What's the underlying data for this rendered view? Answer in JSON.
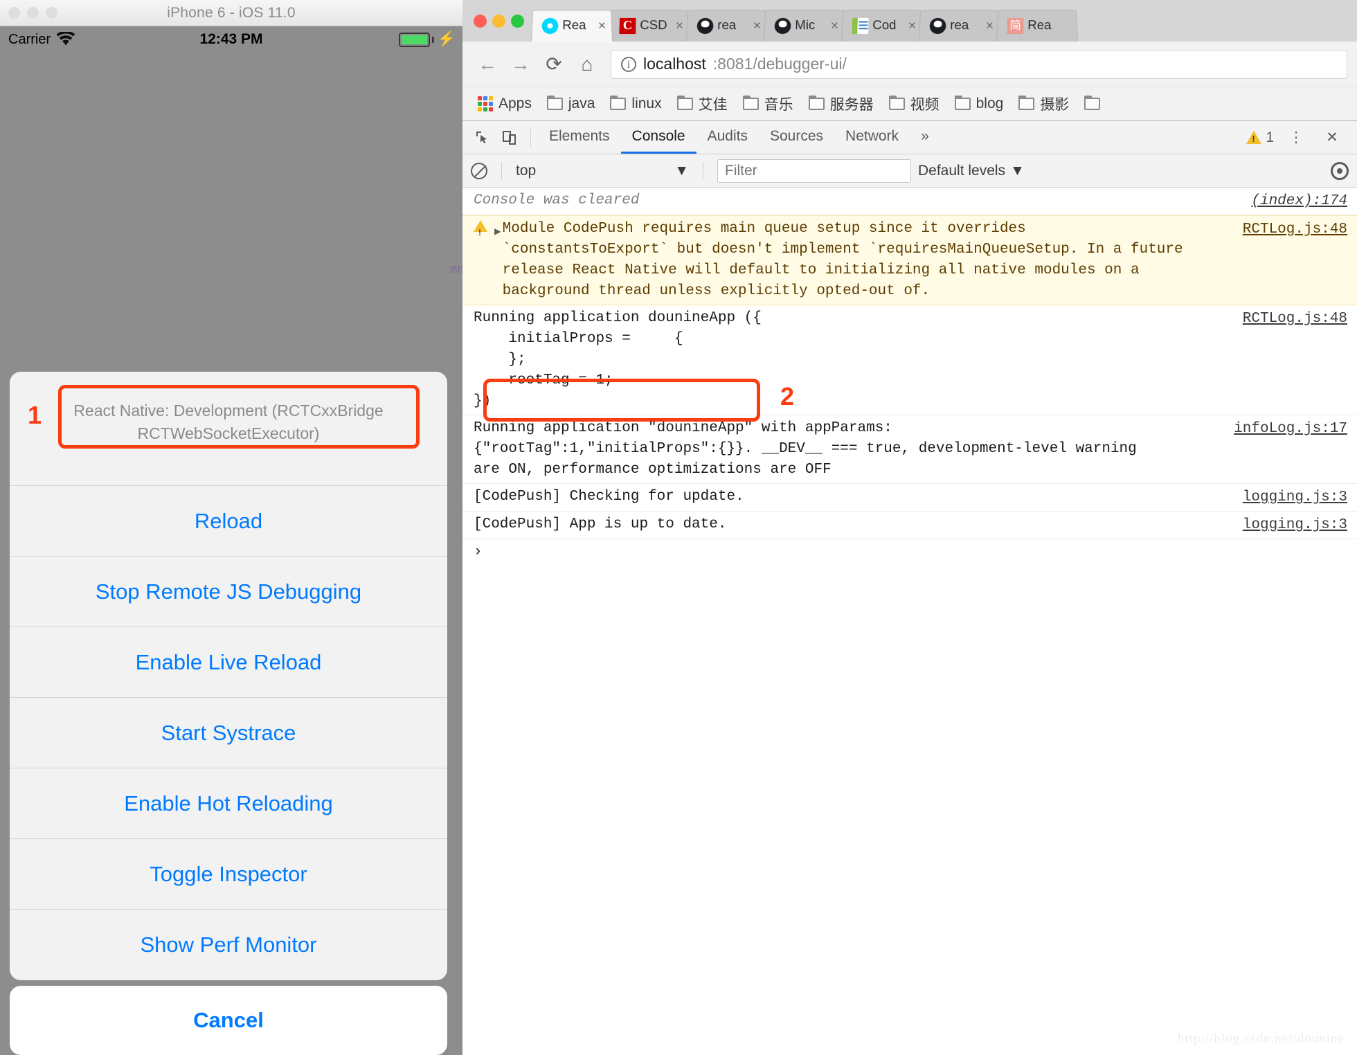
{
  "simulator": {
    "window_title": "iPhone 6 - iOS 11.0",
    "status_bar": {
      "carrier": "Carrier",
      "time": "12:43 PM",
      "wifi_icon": "wifi-icon",
      "battery_icon": "battery-icon",
      "charging_icon": "lightning-bolt-icon"
    },
    "action_sheet": {
      "header": "React Native: Development (RCTCxxBridge RCTWebSocketExecutor)",
      "items": [
        {
          "label": "Reload",
          "highlighted": false
        },
        {
          "label": "Stop Remote JS Debugging",
          "highlighted": true
        },
        {
          "label": "Enable Live Reload",
          "highlighted": false
        },
        {
          "label": "Start Systrace",
          "highlighted": false
        },
        {
          "label": "Enable Hot Reloading",
          "highlighted": false
        },
        {
          "label": "Toggle Inspector",
          "highlighted": false
        },
        {
          "label": "Show Perf Monitor",
          "highlighted": false
        }
      ],
      "cancel_label": "Cancel"
    }
  },
  "annotations": [
    {
      "number": "1",
      "target": "Stop Remote JS Debugging"
    },
    {
      "number": "2",
      "target": "[CodePush] console output"
    }
  ],
  "annotation_color": "#fa3c11",
  "browser": {
    "traffic_lights": [
      "close",
      "minimize",
      "zoom"
    ],
    "tabs": [
      {
        "title": "Rea",
        "favicon": "react-icon",
        "active": true
      },
      {
        "title": "CSD",
        "favicon": "csdn-icon",
        "active": false
      },
      {
        "title": "rea",
        "favicon": "github-icon",
        "active": false
      },
      {
        "title": "Mic",
        "favicon": "github-icon",
        "active": false
      },
      {
        "title": "Cod",
        "favicon": "code-icon",
        "active": false
      },
      {
        "title": "rea",
        "favicon": "github-icon",
        "active": false
      },
      {
        "title": "Rea",
        "favicon": "jianshu-icon",
        "active": false
      }
    ],
    "tab_close_label": "×",
    "nav": {
      "back": "←",
      "forward": "→",
      "reload": "⟳",
      "home": "⌂"
    },
    "omnibox": {
      "host": "localhost",
      "path": ":8081/debugger-ui/",
      "info_icon": "info-icon"
    },
    "bookmarks": [
      {
        "label": "Apps",
        "icon": "apps-grid-icon"
      },
      {
        "label": "java",
        "icon": "folder-icon"
      },
      {
        "label": "linux",
        "icon": "folder-icon"
      },
      {
        "label": "艾佳",
        "icon": "folder-icon"
      },
      {
        "label": "音乐",
        "icon": "folder-icon"
      },
      {
        "label": "服务器",
        "icon": "folder-icon"
      },
      {
        "label": "视频",
        "icon": "folder-icon"
      },
      {
        "label": "blog",
        "icon": "folder-icon"
      },
      {
        "label": "摄影",
        "icon": "folder-icon"
      },
      {
        "label": "",
        "icon": "folder-icon"
      }
    ]
  },
  "devtools": {
    "tabs": [
      {
        "label": "Elements",
        "active": false
      },
      {
        "label": "Console",
        "active": true
      },
      {
        "label": "Audits",
        "active": false
      },
      {
        "label": "Sources",
        "active": false
      },
      {
        "label": "Network",
        "active": false
      }
    ],
    "more_label": "»",
    "warning_count": "1",
    "menu_icon": "kebab-menu-icon",
    "close_icon": "close-icon",
    "inspect_icon": "inspect-element-icon",
    "device_icon": "device-toolbar-icon",
    "filters": {
      "clear_icon": "clear-console-icon",
      "context": "top",
      "context_caret": "▼",
      "filter_placeholder": "Filter",
      "filter_value": "",
      "levels_label": "Default levels",
      "levels_caret": "▼",
      "settings_icon": "gear-icon"
    },
    "console_rows": [
      {
        "type": "cleared",
        "text": "Console was cleared",
        "source": "(index):174"
      },
      {
        "type": "warning",
        "text": "Module CodePush requires main queue setup since it overrides\n`constantsToExport` but doesn't implement `requiresMainQueueSetup. In a future\nrelease React Native will default to initializing all native modules on a\nbackground thread unless explicitly opted-out of.",
        "source": "RCTLog.js:48",
        "has_disclosure": true,
        "has_warn_icon": true
      },
      {
        "type": "log",
        "text": "Running application dounineApp ({\n    initialProps =     {\n    };\n    rootTag = 1;\n})",
        "source": "RCTLog.js:48"
      },
      {
        "type": "log",
        "text": "Running application \"dounineApp\" with appParams:\n{\"rootTag\":1,\"initialProps\":{}}. __DEV__ === true, development-level warning\nare ON, performance optimizations are OFF",
        "source": "infoLog.js:17"
      },
      {
        "type": "log",
        "text": "[CodePush] Checking for update.",
        "source": "logging.js:3"
      },
      {
        "type": "log",
        "text": "[CodePush] App is up to date.",
        "source": "logging.js:3"
      }
    ],
    "prompt_caret": "›"
  },
  "watermark": "http://blog.csdn.net/dounine"
}
